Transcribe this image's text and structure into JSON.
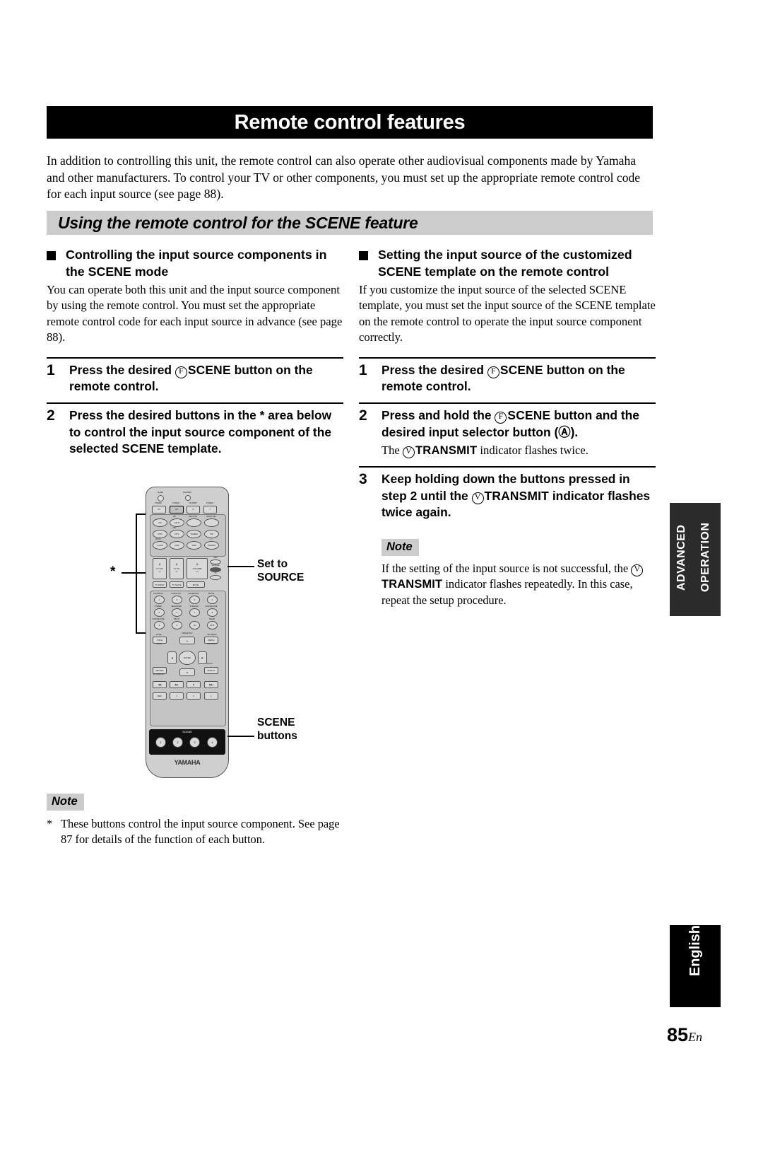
{
  "header": {
    "title": "Remote control features"
  },
  "intro": "In addition to controlling this unit, the remote control can also operate other audiovisual components made by Yamaha and other manufacturers. To control your TV or other components, you must set up the appropriate remote control code for each input source (see page 88).",
  "section_band": {
    "title": "Using the remote control for the SCENE feature"
  },
  "left_column": {
    "subhead": "Controlling the input source components in the SCENE mode",
    "body": "You can operate both this unit and the input source component by using the remote control. You must set the appropriate remote control code for each input source in advance (see page 88).",
    "steps": [
      {
        "number": "1",
        "pre": "Press the desired ",
        "badge": "F",
        "key": "SCENE",
        "post": " button on the remote control."
      },
      {
        "number": "2",
        "pre": "Press the desired buttons in the * area below to control the input source component of the selected SCENE template.",
        "badge": "",
        "key": "",
        "post": ""
      }
    ]
  },
  "right_column": {
    "subhead": "Setting the input source of the customized SCENE template on the remote control",
    "body": "If you customize the input source of the selected SCENE template, you must set the input source of the SCENE template on the remote control to operate the input source component correctly.",
    "steps": [
      {
        "number": "1",
        "pre": "Press the desired ",
        "badge": "F",
        "key": "SCENE",
        "post": " button on the remote control.",
        "sub_note": ""
      },
      {
        "number": "2",
        "pre": "Press and hold the ",
        "badge": "F",
        "key": "SCENE",
        "post": " button and the desired input selector button (Ⓐ).",
        "sub_note_pre": "The ",
        "sub_note_badge": "V",
        "sub_note_key": "TRANSMIT",
        "sub_note_post": " indicator flashes twice."
      },
      {
        "number": "3",
        "pre": "Keep holding down the buttons pressed in step 2 until the ",
        "badge": "V",
        "key": "TRANSMIT",
        "post": " indicator flashes twice again.",
        "sub_note": ""
      }
    ],
    "note": {
      "label": "Note",
      "text_pre": "If the setting of the input source is not successful, the ",
      "badge": "V",
      "key": "TRANSMIT",
      "text_post": " indicator flashes repeatedly. In this case, repeat the setup procedure."
    }
  },
  "figure": {
    "star_mark": "*",
    "callout_set_to_source_line1": "Set to",
    "callout_set_to_source_line2": "SOURCE",
    "callout_scene_line1": "SCENE",
    "callout_scene_line2": "buttons",
    "remote": {
      "brand": "YAMAHA",
      "indicator_left": "SLEEP",
      "indicator_right": "TRANSMIT",
      "power_row_labels": [
        "POWER",
        "POWER",
        "STANDBY",
        "POWER"
      ],
      "power_row_buttons": [
        "TV",
        "AV",
        "⏻",
        "I"
      ],
      "input_top_labels": [
        "",
        "MD",
        "NET/USB",
        "AUDIO SEL"
      ],
      "input_row1": [
        "CD",
        "CD-R",
        "",
        ""
      ],
      "input_mid_labels": [
        "",
        "CBL",
        "",
        ""
      ],
      "input_row2": [
        "DVD",
        "DTV",
        "TUNER",
        "XM"
      ],
      "input_bot_labels": [
        "DOCK",
        "",
        "",
        "☆☆"
      ],
      "input_row3": [
        "V-AUX",
        "DVR",
        "VCR",
        "PHONO"
      ],
      "volume_labels": [
        "TV VOL",
        "TV CH",
        "VOLUME"
      ],
      "plus": "+",
      "minus": "–",
      "slider_labels": [
        "AMP",
        "SOURCE",
        "TV"
      ],
      "small_row": [
        "TV INPUT",
        "TV MUTE",
        "MUTE"
      ],
      "numeric_top_labels": [
        "CLASSICAL",
        "LIVE/CLUB",
        "ENTERTAIN",
        "MOVIE"
      ],
      "numeric_row1": [
        "1",
        "2",
        "3",
        "4"
      ],
      "numeric_mid_labels": [
        "STEREO",
        "ENHANCER",
        "STRAIGHT",
        "SUR DECODE"
      ],
      "numeric_row2": [
        "5",
        "6",
        "7",
        "8"
      ],
      "numeric_bot_labels": [
        "SUR DECODE",
        "NIGHT",
        "",
        "SLEEP"
      ],
      "numeric_row3": [
        "9",
        "0",
        "+10",
        "ENT"
      ],
      "nav_labels": [
        "LEVEL",
        "PRESET/CH",
        "SET MENU"
      ],
      "nav_sub_labels": [
        "BAND",
        "",
        "SRC/INPUT"
      ],
      "nav_buttons": [
        "TITLE",
        "MENU"
      ],
      "nav_enter": "ENTER",
      "nav_return": "RETURN",
      "nav_memory": "EX MEMORY",
      "nav_display": "DISPLAY",
      "nav_aebsat": "A-E/CAT.",
      "transport_row1": [
        "◀◀",
        "▶▶",
        "■",
        "▶▶|"
      ],
      "transport_row2": [
        "REC",
        "□",
        "‖",
        "▷"
      ],
      "scene_label": "SCENE",
      "scene_numbers": [
        "1",
        "2",
        "3",
        "4"
      ]
    }
  },
  "left_note": {
    "label": "Note",
    "star": "*",
    "text": "These buttons control the input source component. See page 87 for details of the function of each button."
  },
  "side_tabs": {
    "advanced": "ADVANCED OPERATION",
    "language": "English"
  },
  "footer": {
    "page_number": "85",
    "lang_suffix": "En"
  },
  "colors": {
    "title_bar": "#000000",
    "band": "#cccccc",
    "note_tag": "#cccccc",
    "tab_dark": "#2b2b2b",
    "remote_body": "#cfcfcf"
  }
}
